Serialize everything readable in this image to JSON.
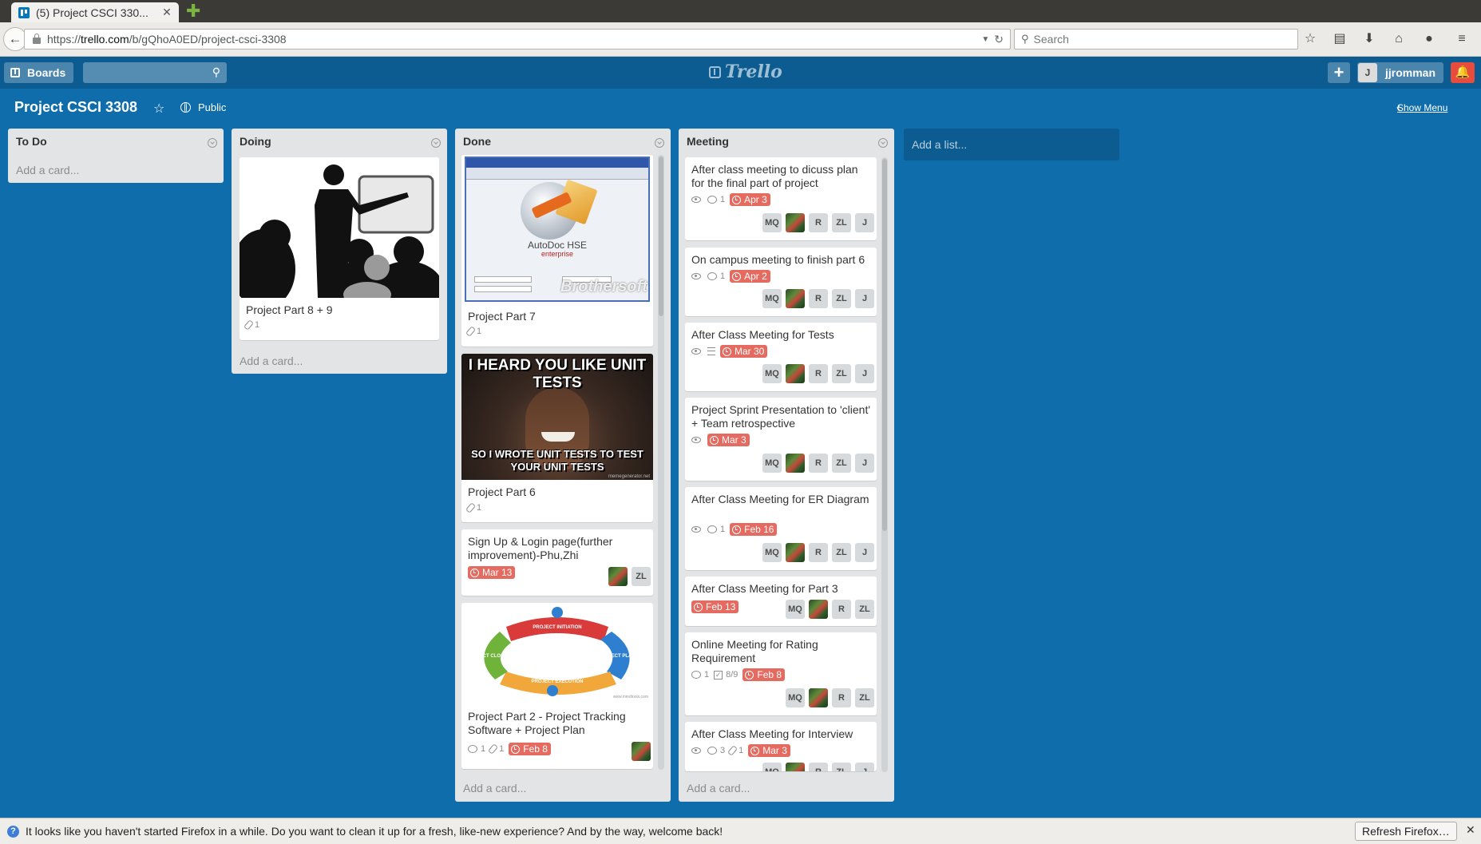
{
  "browser": {
    "tab_title": "(5) Project CSCI 330...",
    "tab_close": "✕",
    "new_tab": "✚",
    "url_prefix": "https://",
    "url_host": "trello.com",
    "url_path": "/b/gQhoA0ED/project-csci-3308",
    "search_placeholder": "Search"
  },
  "header": {
    "boards_label": "Boards",
    "logo_text": "Trello",
    "add_label": "+",
    "member_initial": "J",
    "username": "jjromman"
  },
  "board": {
    "title": "Project CSCI 3308",
    "visibility": "Public",
    "show_menu": "Show Menu",
    "add_list": "Add a list..."
  },
  "lists": [
    {
      "title": "To Do",
      "add_card": "Add a card..."
    },
    {
      "title": "Doing",
      "add_card": "Add a card..."
    },
    {
      "title": "Done",
      "add_card": "Add a card..."
    },
    {
      "title": "Meeting",
      "add_card": "Add a card..."
    }
  ],
  "doing_cards": [
    {
      "title": "Project Part 8 + 9",
      "attachments": "1"
    }
  ],
  "done_cards": [
    {
      "title": "Project Part 7",
      "attachments": "1",
      "image_caption": "AutoDoc HSE",
      "image_sub": "enterprise",
      "image_watermark": "Brothersoft"
    },
    {
      "title": "Project Part 6",
      "attachments": "1",
      "meme_top": "I HEARD YOU LIKE UNIT TESTS",
      "meme_bottom": "SO I WROTE UNIT TESTS TO TEST YOUR UNIT TESTS",
      "meme_credit": "memegenerator.net"
    },
    {
      "title": "Sign Up & Login page(further improvement)-Phu,Zhi",
      "due": "Mar 13",
      "members": [
        "photo",
        "ZL"
      ]
    },
    {
      "title": "Project Part 2 - Project Tracking Software + Project Plan",
      "comments": "1",
      "attachments": "1",
      "due": "Feb 8",
      "members": [
        "photo"
      ],
      "diagram_labels": [
        "PROJECT INITIATION",
        "PROJECT PLANNING",
        "PROJECT EXECUTION",
        "PROJECT CLOSURE"
      ],
      "diagram_credit": "www.mindtools.com"
    }
  ],
  "meeting_cards": [
    {
      "title": "After class meeting to dicuss plan for the final part of project",
      "watching": true,
      "comments": "1",
      "due": "Apr 3",
      "members": [
        "MQ",
        "photo",
        "R",
        "ZL",
        "J"
      ]
    },
    {
      "title": "On campus meeting to finish part 6",
      "watching": true,
      "comments": "1",
      "due": "Apr 2",
      "members": [
        "MQ",
        "photo",
        "R",
        "ZL",
        "J"
      ]
    },
    {
      "title": "After Class Meeting for Tests",
      "watching": true,
      "description": true,
      "due": "Mar 30",
      "members": [
        "MQ",
        "photo",
        "R",
        "ZL",
        "J"
      ]
    },
    {
      "title": "Project Sprint Presentation to 'client' + Team retrospective",
      "watching": true,
      "due": "Mar 3",
      "members": [
        "MQ",
        "photo",
        "R",
        "ZL",
        "J"
      ]
    },
    {
      "title": "After Class Meeting for ER Diagram",
      "watching": true,
      "comments": "1",
      "due": "Feb 16",
      "members": [
        "MQ",
        "photo",
        "R",
        "ZL",
        "J"
      ]
    },
    {
      "title": "After Class Meeting for Part 3",
      "due": "Feb 13",
      "members": [
        "MQ",
        "photo",
        "R",
        "ZL"
      ]
    },
    {
      "title": "Online Meeting for Rating Requirement",
      "comments": "1",
      "checklist": "8/9",
      "due": "Feb 8",
      "members": [
        "MQ",
        "photo",
        "R",
        "ZL"
      ]
    },
    {
      "title": "After Class Meeting for Interview",
      "watching": true,
      "comments": "3",
      "attachments": "1",
      "due": "Mar 3",
      "members": [
        "MQ",
        "photo",
        "R",
        "ZL",
        "J"
      ]
    }
  ],
  "notification": {
    "message": "It looks like you haven't started Firefox in a while. Do you want to clean it up for a fresh, like-new experience? And by the way, welcome back!",
    "button": "Refresh Firefox…",
    "close": "✕"
  },
  "colors": {
    "board_bg": "#0f6dab",
    "header_bg": "#0c5c91",
    "list_bg": "#e2e4e6",
    "due_badge": "#e56b61",
    "notification_button": "#e74c3c"
  }
}
